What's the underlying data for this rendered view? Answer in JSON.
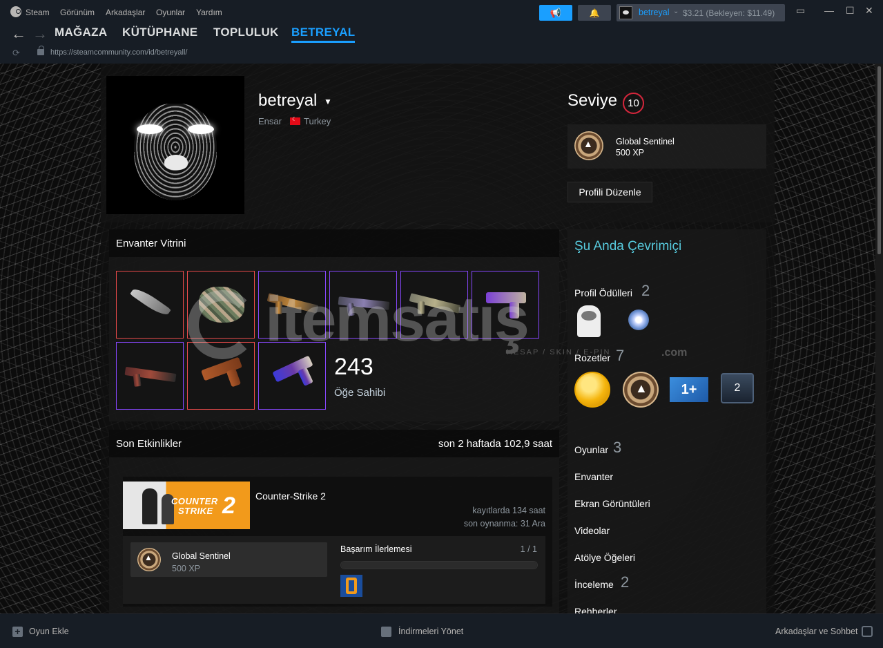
{
  "menubar": {
    "app": "Steam",
    "items": [
      "Görünüm",
      "Arkadaşlar",
      "Oyunlar",
      "Yardım"
    ],
    "account_name": "betreyal",
    "wallet": "$3.21 (Bekleyen: $11.49)"
  },
  "nav": {
    "tabs": [
      "MAĞAZA",
      "KÜTÜPHANE",
      "TOPLULUK",
      "BETREYAL"
    ],
    "active_tab": "BETREYAL",
    "url": "https://steamcommunity.com/id/betreyall/"
  },
  "profile": {
    "name": "betreyal",
    "real_name": "Ensar",
    "country": "Turkey",
    "level_label": "Seviye",
    "level": "10",
    "favorite_badge": {
      "name": "Global Sentinel",
      "xp": "500 XP"
    },
    "edit_button": "Profili Düzenle"
  },
  "showcase": {
    "title": "Envanter Vitrini",
    "item_count": "243",
    "item_count_label": "Öğe Sahibi",
    "items": [
      {
        "type": "knife",
        "rarity": "red"
      },
      {
        "type": "gloves",
        "rarity": "red"
      },
      {
        "type": "rifle-ak",
        "rarity": "purple"
      },
      {
        "type": "rifle-sg",
        "rarity": "purple"
      },
      {
        "type": "sniper",
        "rarity": "purple"
      },
      {
        "type": "pistol-glock",
        "rarity": "purple"
      },
      {
        "type": "rifle-m4",
        "rarity": "purple"
      },
      {
        "type": "pistol-deagle",
        "rarity": "red"
      },
      {
        "type": "revolver",
        "rarity": "purple"
      }
    ]
  },
  "watermark": {
    "word": "itemsatış",
    "tagline": "HESAP / SKIN / E-PIN",
    "domain": ".com"
  },
  "recent": {
    "title": "Son Etkinlikler",
    "summary": "son 2 haftada 102,9 saat",
    "game": {
      "name": "Counter-Strike 2",
      "capsule_line1": "COUNTER",
      "capsule_line2": "STRIKE",
      "capsule_number": "2",
      "hours": "kayıtlarda 134 saat",
      "last_played": "son oynanma: 31 Ara",
      "badge_name": "Global Sentinel",
      "badge_xp": "500 XP",
      "achievement_label": "Başarım İlerlemesi",
      "achievement_count": "1 / 1",
      "achievement_progress": 1.0
    }
  },
  "sidebar": {
    "status": "Şu Anda Çevrimiçi",
    "awards_label": "Profil Ödülleri",
    "awards_count": "2",
    "badges_label": "Rozetler",
    "badges_count": "7",
    "badge_one_label": "1+",
    "badge_two_label": "2",
    "games_label": "Oyunlar",
    "games_count": "3",
    "inventory_label": "Envanter",
    "screenshots_label": "Ekran Görüntüleri",
    "videos_label": "Videolar",
    "workshop_label": "Atölye Öğeleri",
    "reviews_label": "İnceleme",
    "reviews_count": "2",
    "guides_label": "Rehberler"
  },
  "bottombar": {
    "add_game": "Oyun Ekle",
    "downloads": "İndirmeleri Yönet",
    "friends": "Arkadaşlar ve Sohbet"
  },
  "colors": {
    "accent": "#1a9fff",
    "online": "#57cbde",
    "level_ring": "#d4263c",
    "rarity_red": "#eb4b4b",
    "rarity_purple": "#8847ff"
  }
}
